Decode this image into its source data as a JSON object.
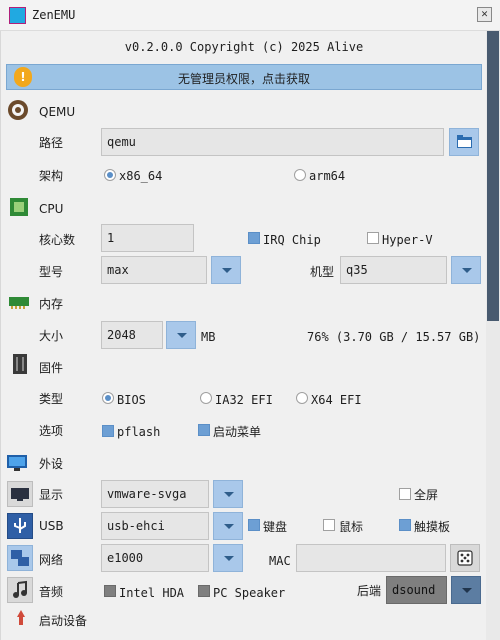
{
  "window": {
    "title": "ZenEMU",
    "close_glyph": "✕"
  },
  "version_text": "v0.2.0.0 Copyright (c) 2025 Alive",
  "banner": {
    "text": "无管理员权限，点击获取",
    "icon": "warning-shield-icon"
  },
  "qemu": {
    "section": "QEMU",
    "path_label": "路径",
    "path_value": "qemu",
    "arch_label": "架构",
    "arch_options": [
      "x86_64",
      "arm64"
    ],
    "arch_selected": "x86_64"
  },
  "cpu": {
    "section": "CPU",
    "cores_label": "核心数",
    "cores_value": "1",
    "irq_chip": "IRQ Chip",
    "irq_chip_checked": true,
    "hyperv": "Hyper-V",
    "hyperv_checked": false,
    "model_label": "型号",
    "model_value": "max",
    "machine_label": "机型",
    "machine_value": "q35"
  },
  "memory": {
    "section": "内存",
    "size_label": "大小",
    "size_value": "2048",
    "unit": "MB",
    "usage_text": "76% (3.70 GB / 15.57 GB)"
  },
  "firmware": {
    "section": "固件",
    "type_label": "类型",
    "type_options": [
      "BIOS",
      "IA32 EFI",
      "X64 EFI"
    ],
    "type_selected": "BIOS",
    "options_label": "选项",
    "pflash": "pflash",
    "pflash_checked": true,
    "boot_menu": "启动菜单",
    "boot_menu_checked": true
  },
  "peripherals": {
    "section": "外设",
    "display_label": "显示",
    "display_value": "vmware-svga",
    "fullscreen": "全屏",
    "fullscreen_checked": false,
    "usb_label": "USB",
    "usb_value": "usb-ehci",
    "keyboard": "键盘",
    "keyboard_checked": true,
    "mouse": "鼠标",
    "mouse_checked": false,
    "touchpad": "触摸板",
    "touchpad_checked": true,
    "network_label": "网络",
    "network_value": "e1000",
    "mac_label": "MAC",
    "mac_value": "",
    "audio_label": "音频",
    "intel_hda": "Intel HDA",
    "intel_hda_checked": true,
    "pc_speaker": "PC Speaker",
    "pc_speaker_checked": true,
    "backend_label": "后端",
    "backend_value": "dsound"
  },
  "boot": {
    "section": "启动设备"
  },
  "colors": {
    "accent": "#a9c8ea",
    "banner": "#9cc3e5",
    "warning": "#f2a81d",
    "scroll_thumb": "#485a6f"
  }
}
